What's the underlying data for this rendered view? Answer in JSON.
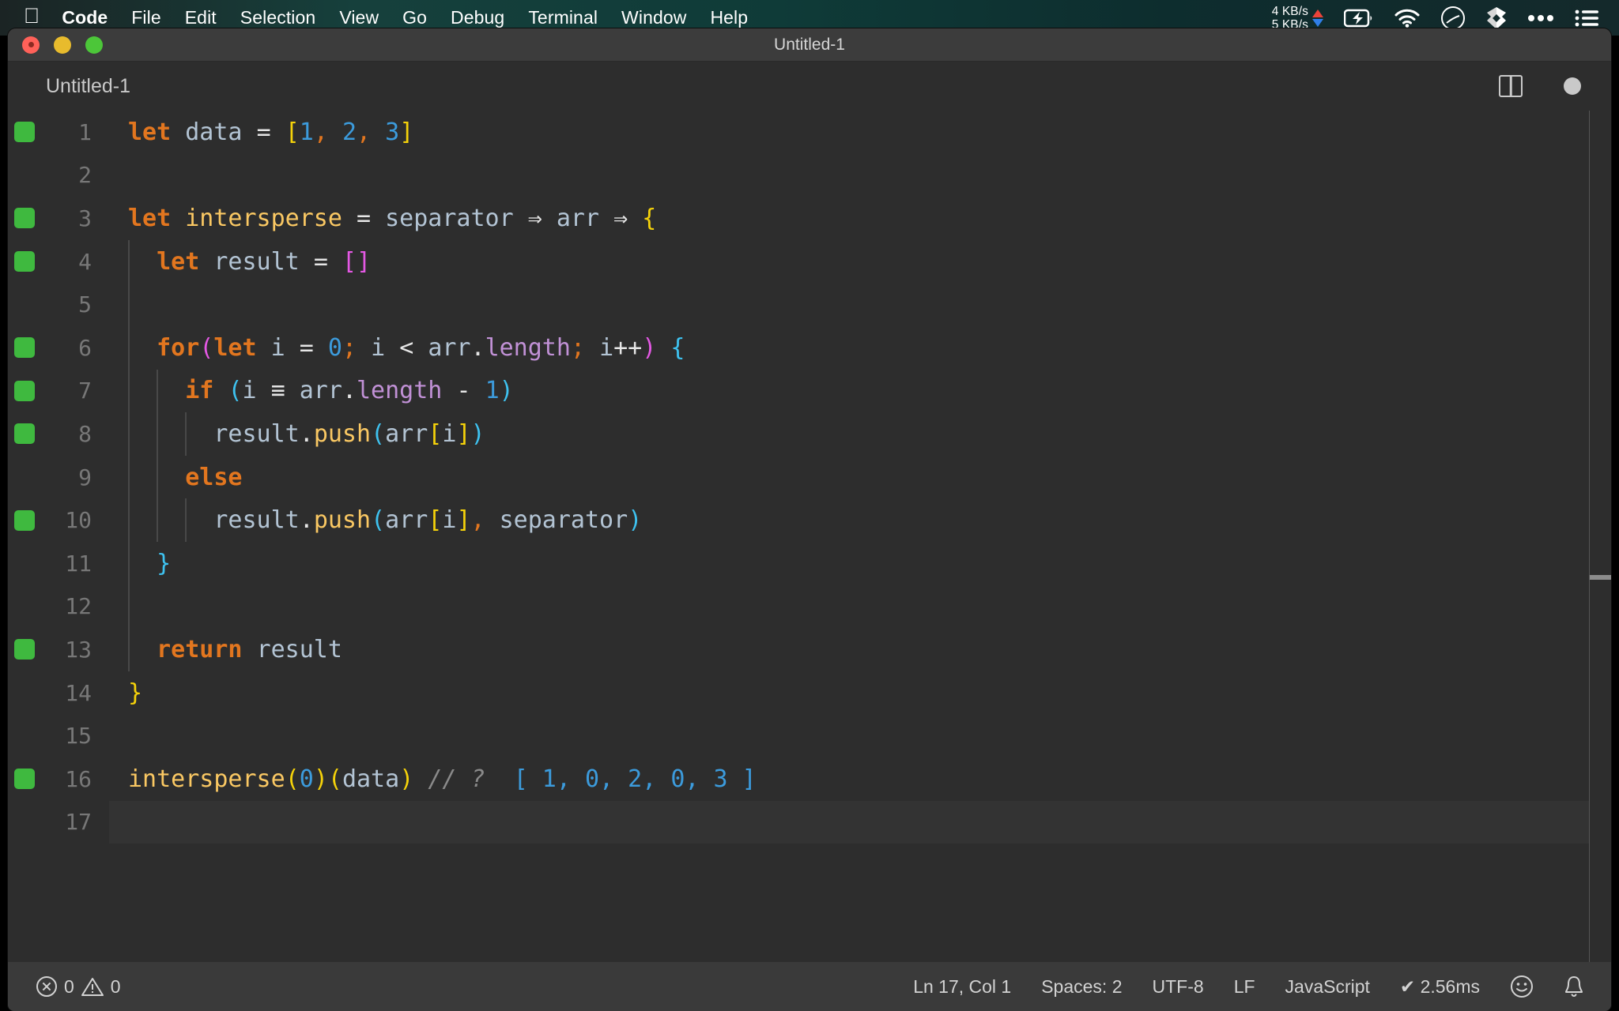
{
  "menubar": {
    "apple_glyph": "",
    "items": [
      {
        "label": "Code",
        "bold": true
      },
      {
        "label": "File",
        "bold": false
      },
      {
        "label": "Edit",
        "bold": false
      },
      {
        "label": "Selection",
        "bold": false
      },
      {
        "label": "View",
        "bold": false
      },
      {
        "label": "Go",
        "bold": false
      },
      {
        "label": "Debug",
        "bold": false
      },
      {
        "label": "Terminal",
        "bold": false
      },
      {
        "label": "Window",
        "bold": false
      },
      {
        "label": "Help",
        "bold": false
      }
    ],
    "status": {
      "net_up": "4 KB/s",
      "net_down": "5 KB/s",
      "icons": [
        "battery-charging-icon",
        "wifi-icon",
        "do-not-disturb-icon",
        "dropbox-icon",
        "ellipsis-icon",
        "control-center-icon"
      ]
    }
  },
  "window": {
    "title": "Untitled-1",
    "traffic_lights": [
      "close-button",
      "minimize-button",
      "zoom-button"
    ]
  },
  "editor_header": {
    "tab_label": "Untitled-1",
    "actions": [
      "split-editor-icon",
      "unsaved-dot-indicator"
    ]
  },
  "editor": {
    "active_line": 17,
    "lines": [
      {
        "n": 1,
        "bp": true,
        "indent": 0,
        "tokens": [
          {
            "t": "let",
            "c": "t-key"
          },
          {
            "t": " ",
            "c": ""
          },
          {
            "t": "data",
            "c": "t-var"
          },
          {
            "t": " ",
            "c": ""
          },
          {
            "t": "=",
            "c": "t-op"
          },
          {
            "t": " ",
            "c": ""
          },
          {
            "t": "[",
            "c": "t-br-y"
          },
          {
            "t": "1",
            "c": "t-num"
          },
          {
            "t": ",",
            "c": "t-comma-o"
          },
          {
            "t": " ",
            "c": ""
          },
          {
            "t": "2",
            "c": "t-num"
          },
          {
            "t": ",",
            "c": "t-comma-o"
          },
          {
            "t": " ",
            "c": ""
          },
          {
            "t": "3",
            "c": "t-num"
          },
          {
            "t": "]",
            "c": "t-br-y"
          }
        ]
      },
      {
        "n": 2,
        "bp": false,
        "indent": 0,
        "tokens": []
      },
      {
        "n": 3,
        "bp": true,
        "indent": 0,
        "tokens": [
          {
            "t": "let",
            "c": "t-key"
          },
          {
            "t": " ",
            "c": ""
          },
          {
            "t": "intersperse",
            "c": "t-fn"
          },
          {
            "t": " ",
            "c": ""
          },
          {
            "t": "=",
            "c": "t-op"
          },
          {
            "t": " ",
            "c": ""
          },
          {
            "t": "separator",
            "c": "t-var"
          },
          {
            "t": " ",
            "c": ""
          },
          {
            "t": "⇒",
            "c": "t-op"
          },
          {
            "t": " ",
            "c": ""
          },
          {
            "t": "arr",
            "c": "t-var"
          },
          {
            "t": " ",
            "c": ""
          },
          {
            "t": "⇒",
            "c": "t-op"
          },
          {
            "t": " ",
            "c": ""
          },
          {
            "t": "{",
            "c": "t-br-y"
          }
        ]
      },
      {
        "n": 4,
        "bp": true,
        "indent": 1,
        "tokens": [
          {
            "t": "  ",
            "c": ""
          },
          {
            "t": "let",
            "c": "t-key"
          },
          {
            "t": " ",
            "c": ""
          },
          {
            "t": "result",
            "c": "t-var"
          },
          {
            "t": " ",
            "c": ""
          },
          {
            "t": "=",
            "c": "t-op"
          },
          {
            "t": " ",
            "c": ""
          },
          {
            "t": "[]",
            "c": "t-br-m"
          }
        ]
      },
      {
        "n": 5,
        "bp": false,
        "indent": 1,
        "tokens": []
      },
      {
        "n": 6,
        "bp": true,
        "indent": 1,
        "tokens": [
          {
            "t": "  ",
            "c": ""
          },
          {
            "t": "for",
            "c": "t-key"
          },
          {
            "t": "(",
            "c": "t-br-m"
          },
          {
            "t": "let",
            "c": "t-key"
          },
          {
            "t": " ",
            "c": ""
          },
          {
            "t": "i",
            "c": "t-var"
          },
          {
            "t": " ",
            "c": ""
          },
          {
            "t": "=",
            "c": "t-op"
          },
          {
            "t": " ",
            "c": ""
          },
          {
            "t": "0",
            "c": "t-num"
          },
          {
            "t": ";",
            "c": "t-comma-o"
          },
          {
            "t": " ",
            "c": ""
          },
          {
            "t": "i",
            "c": "t-var"
          },
          {
            "t": " ",
            "c": ""
          },
          {
            "t": "<",
            "c": "t-op"
          },
          {
            "t": " ",
            "c": ""
          },
          {
            "t": "arr",
            "c": "t-var"
          },
          {
            "t": ".",
            "c": "t-op"
          },
          {
            "t": "length",
            "c": "t-prop"
          },
          {
            "t": ";",
            "c": "t-comma-o"
          },
          {
            "t": " ",
            "c": ""
          },
          {
            "t": "i",
            "c": "t-var"
          },
          {
            "t": "++",
            "c": "t-op"
          },
          {
            "t": ")",
            "c": "t-br-m"
          },
          {
            "t": " ",
            "c": ""
          },
          {
            "t": "{",
            "c": "t-br-c"
          }
        ]
      },
      {
        "n": 7,
        "bp": true,
        "indent": 2,
        "tokens": [
          {
            "t": "    ",
            "c": ""
          },
          {
            "t": "if",
            "c": "t-key"
          },
          {
            "t": " ",
            "c": ""
          },
          {
            "t": "(",
            "c": "t-br-c"
          },
          {
            "t": "i",
            "c": "t-var"
          },
          {
            "t": " ",
            "c": ""
          },
          {
            "t": "≡",
            "c": "t-op"
          },
          {
            "t": " ",
            "c": ""
          },
          {
            "t": "arr",
            "c": "t-var"
          },
          {
            "t": ".",
            "c": "t-op"
          },
          {
            "t": "length",
            "c": "t-prop"
          },
          {
            "t": " ",
            "c": ""
          },
          {
            "t": "-",
            "c": "t-op"
          },
          {
            "t": " ",
            "c": ""
          },
          {
            "t": "1",
            "c": "t-num"
          },
          {
            "t": ")",
            "c": "t-br-c"
          }
        ]
      },
      {
        "n": 8,
        "bp": true,
        "indent": 3,
        "tokens": [
          {
            "t": "      ",
            "c": ""
          },
          {
            "t": "result",
            "c": "t-var"
          },
          {
            "t": ".",
            "c": "t-op"
          },
          {
            "t": "push",
            "c": "t-method"
          },
          {
            "t": "(",
            "c": "t-br-c"
          },
          {
            "t": "arr",
            "c": "t-var"
          },
          {
            "t": "[",
            "c": "t-br-y"
          },
          {
            "t": "i",
            "c": "t-var"
          },
          {
            "t": "]",
            "c": "t-br-y"
          },
          {
            "t": ")",
            "c": "t-br-c"
          }
        ]
      },
      {
        "n": 9,
        "bp": false,
        "indent": 2,
        "tokens": [
          {
            "t": "    ",
            "c": ""
          },
          {
            "t": "else",
            "c": "t-key"
          }
        ]
      },
      {
        "n": 10,
        "bp": true,
        "indent": 3,
        "tokens": [
          {
            "t": "      ",
            "c": ""
          },
          {
            "t": "result",
            "c": "t-var"
          },
          {
            "t": ".",
            "c": "t-op"
          },
          {
            "t": "push",
            "c": "t-method"
          },
          {
            "t": "(",
            "c": "t-br-c"
          },
          {
            "t": "arr",
            "c": "t-var"
          },
          {
            "t": "[",
            "c": "t-br-y"
          },
          {
            "t": "i",
            "c": "t-var"
          },
          {
            "t": "]",
            "c": "t-br-y"
          },
          {
            "t": ",",
            "c": "t-comma-o"
          },
          {
            "t": " ",
            "c": ""
          },
          {
            "t": "separator",
            "c": "t-var"
          },
          {
            "t": ")",
            "c": "t-br-c"
          }
        ]
      },
      {
        "n": 11,
        "bp": false,
        "indent": 1,
        "tokens": [
          {
            "t": "  ",
            "c": ""
          },
          {
            "t": "}",
            "c": "t-br-c"
          }
        ]
      },
      {
        "n": 12,
        "bp": false,
        "indent": 1,
        "tokens": []
      },
      {
        "n": 13,
        "bp": true,
        "indent": 1,
        "tokens": [
          {
            "t": "  ",
            "c": ""
          },
          {
            "t": "return",
            "c": "t-key"
          },
          {
            "t": " ",
            "c": ""
          },
          {
            "t": "result",
            "c": "t-var"
          }
        ]
      },
      {
        "n": 14,
        "bp": false,
        "indent": 0,
        "tokens": [
          {
            "t": "}",
            "c": "t-br-y"
          }
        ]
      },
      {
        "n": 15,
        "bp": false,
        "indent": 0,
        "tokens": []
      },
      {
        "n": 16,
        "bp": true,
        "indent": 0,
        "tokens": [
          {
            "t": "intersperse",
            "c": "t-fn"
          },
          {
            "t": "(",
            "c": "t-br-y"
          },
          {
            "t": "0",
            "c": "t-num"
          },
          {
            "t": ")",
            "c": "t-br-y"
          },
          {
            "t": "(",
            "c": "t-br-y"
          },
          {
            "t": "data",
            "c": "t-var"
          },
          {
            "t": ")",
            "c": "t-br-y"
          },
          {
            "t": " ",
            "c": ""
          },
          {
            "t": "// ?",
            "c": "t-comment"
          },
          {
            "t": "  ",
            "c": ""
          },
          {
            "t": "[ 1, 0, 2, 0, 3 ]",
            "c": "t-result"
          }
        ]
      },
      {
        "n": 17,
        "bp": false,
        "indent": 0,
        "tokens": []
      }
    ]
  },
  "statusbar": {
    "errors": "0",
    "warnings": "0",
    "cursor": "Ln 17, Col 1",
    "indent": "Spaces: 2",
    "encoding": "UTF-8",
    "eol": "LF",
    "language": "JavaScript",
    "runtime": "✔ 2.56ms",
    "feedback_icon": "smiley-icon",
    "notifications_icon": "bell-icon"
  },
  "colors": {
    "editor_bg": "#2d2d2d",
    "statusbar_bg": "#3a3a3a",
    "titlebar_bg": "#3c3c3c",
    "breakpoint_green": "#3fb93f",
    "menubar_teal": "#0f3b38"
  }
}
